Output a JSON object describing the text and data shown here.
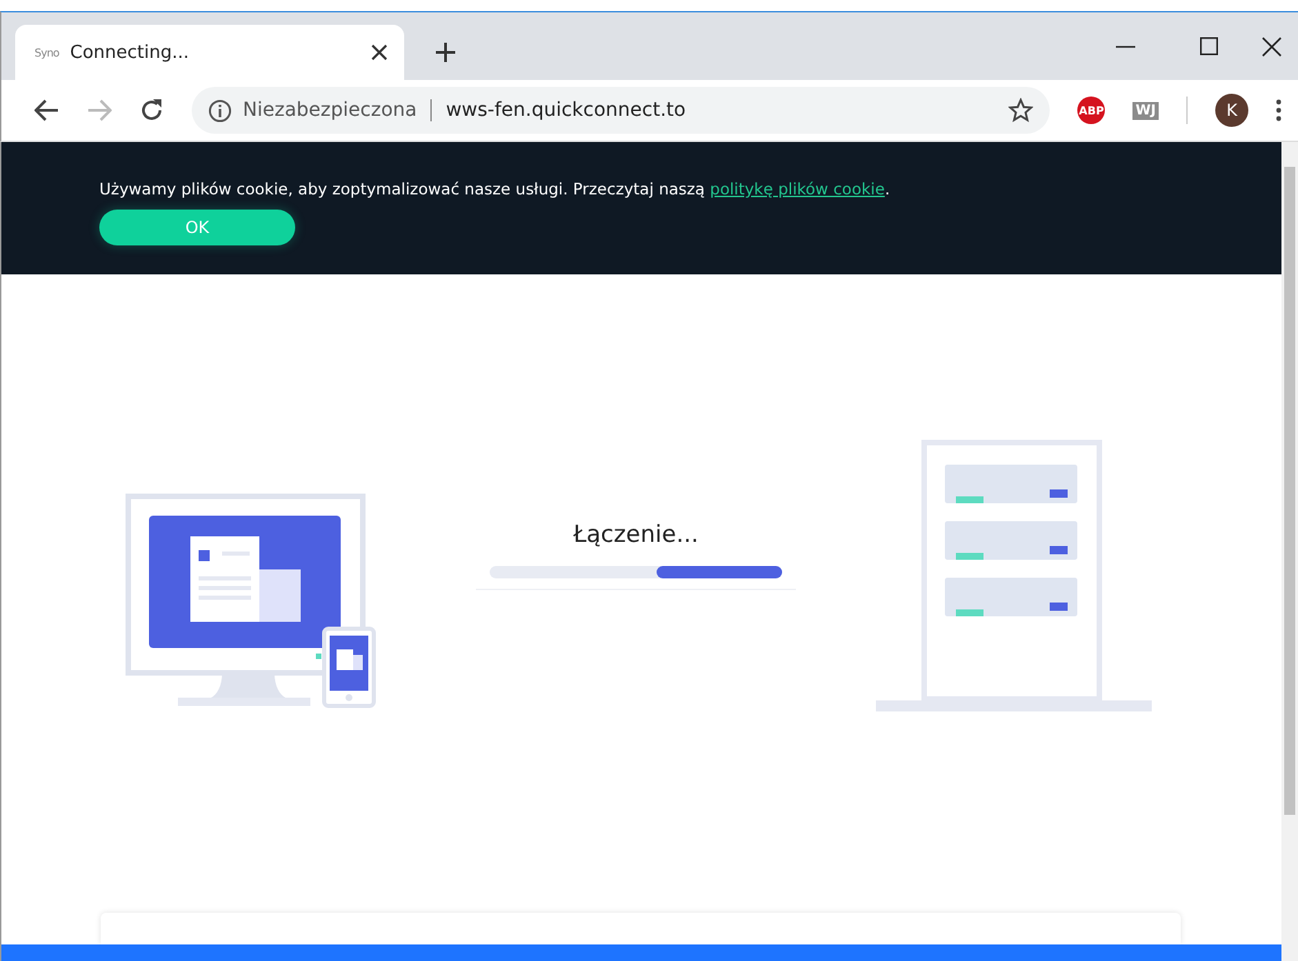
{
  "browser": {
    "tab": {
      "favicon_text": "Syno",
      "title": "Connecting..."
    },
    "address": {
      "security_label": "Niezabezpieczona",
      "url": "wws-fen.quickconnect.to"
    },
    "extensions": [
      {
        "kind": "abp",
        "label": "ABP"
      },
      {
        "kind": "wj",
        "label": "WJ"
      }
    ],
    "profile_initial": "K"
  },
  "cookie_banner": {
    "message": "Używamy plików cookie, aby zoptymalizować nasze usługi. Przeczytaj naszą ",
    "link": "politykę plików cookie",
    "suffix": ".",
    "button": "OK"
  },
  "status": {
    "text": "Łączenie..."
  }
}
